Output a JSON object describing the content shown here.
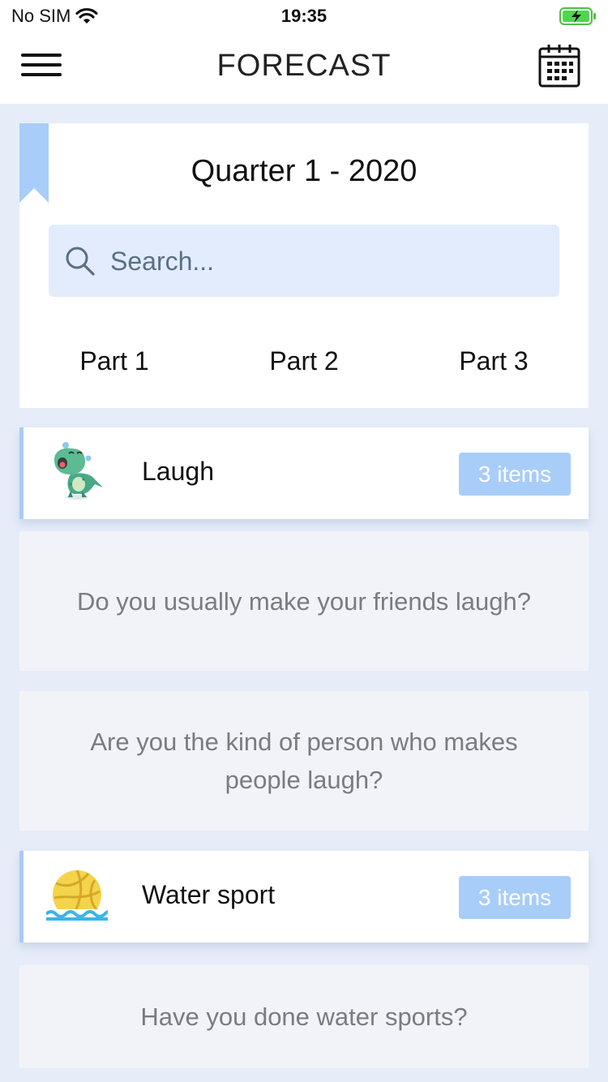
{
  "status_bar": {
    "carrier": "No SIM",
    "time": "19:35",
    "battery": "charging"
  },
  "header": {
    "title": "FORECAST",
    "menu_icon": "hamburger-menu-icon",
    "calendar_icon": "calendar-icon"
  },
  "quarter": {
    "title": "Quarter 1 - 2020",
    "search": {
      "placeholder": "Search...",
      "value": ""
    },
    "tabs": [
      "Part 1",
      "Part 2",
      "Part 3"
    ]
  },
  "categories": [
    {
      "name": "Laugh",
      "badge": "3 items",
      "icon": "laughing-dinosaur-icon",
      "questions": [
        "Do you usually make your friends laugh?",
        "Are you the kind of person who makes people laugh?"
      ]
    },
    {
      "name": "Water sport",
      "badge": "3 items",
      "icon": "water-polo-ball-icon",
      "questions": [
        "Have you done water sports?"
      ]
    }
  ],
  "colors": {
    "page_background": "#e6edf9",
    "accent_light_blue": "#a8cdf8",
    "search_background": "#e3ecfc",
    "question_text": "#7b7b80"
  }
}
